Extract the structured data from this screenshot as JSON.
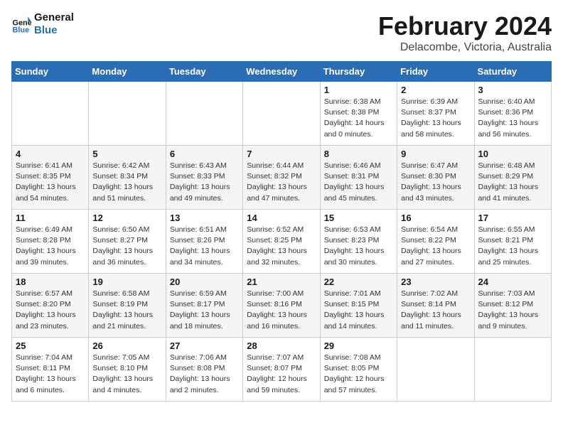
{
  "logo": {
    "line1": "General",
    "line2": "Blue"
  },
  "title": "February 2024",
  "location": "Delacombe, Victoria, Australia",
  "weekdays": [
    "Sunday",
    "Monday",
    "Tuesday",
    "Wednesday",
    "Thursday",
    "Friday",
    "Saturday"
  ],
  "weeks": [
    [
      {
        "day": "",
        "info": ""
      },
      {
        "day": "",
        "info": ""
      },
      {
        "day": "",
        "info": ""
      },
      {
        "day": "",
        "info": ""
      },
      {
        "day": "1",
        "info": "Sunrise: 6:38 AM\nSunset: 8:38 PM\nDaylight: 14 hours\nand 0 minutes."
      },
      {
        "day": "2",
        "info": "Sunrise: 6:39 AM\nSunset: 8:37 PM\nDaylight: 13 hours\nand 58 minutes."
      },
      {
        "day": "3",
        "info": "Sunrise: 6:40 AM\nSunset: 8:36 PM\nDaylight: 13 hours\nand 56 minutes."
      }
    ],
    [
      {
        "day": "4",
        "info": "Sunrise: 6:41 AM\nSunset: 8:35 PM\nDaylight: 13 hours\nand 54 minutes."
      },
      {
        "day": "5",
        "info": "Sunrise: 6:42 AM\nSunset: 8:34 PM\nDaylight: 13 hours\nand 51 minutes."
      },
      {
        "day": "6",
        "info": "Sunrise: 6:43 AM\nSunset: 8:33 PM\nDaylight: 13 hours\nand 49 minutes."
      },
      {
        "day": "7",
        "info": "Sunrise: 6:44 AM\nSunset: 8:32 PM\nDaylight: 13 hours\nand 47 minutes."
      },
      {
        "day": "8",
        "info": "Sunrise: 6:46 AM\nSunset: 8:31 PM\nDaylight: 13 hours\nand 45 minutes."
      },
      {
        "day": "9",
        "info": "Sunrise: 6:47 AM\nSunset: 8:30 PM\nDaylight: 13 hours\nand 43 minutes."
      },
      {
        "day": "10",
        "info": "Sunrise: 6:48 AM\nSunset: 8:29 PM\nDaylight: 13 hours\nand 41 minutes."
      }
    ],
    [
      {
        "day": "11",
        "info": "Sunrise: 6:49 AM\nSunset: 8:28 PM\nDaylight: 13 hours\nand 39 minutes."
      },
      {
        "day": "12",
        "info": "Sunrise: 6:50 AM\nSunset: 8:27 PM\nDaylight: 13 hours\nand 36 minutes."
      },
      {
        "day": "13",
        "info": "Sunrise: 6:51 AM\nSunset: 8:26 PM\nDaylight: 13 hours\nand 34 minutes."
      },
      {
        "day": "14",
        "info": "Sunrise: 6:52 AM\nSunset: 8:25 PM\nDaylight: 13 hours\nand 32 minutes."
      },
      {
        "day": "15",
        "info": "Sunrise: 6:53 AM\nSunset: 8:23 PM\nDaylight: 13 hours\nand 30 minutes."
      },
      {
        "day": "16",
        "info": "Sunrise: 6:54 AM\nSunset: 8:22 PM\nDaylight: 13 hours\nand 27 minutes."
      },
      {
        "day": "17",
        "info": "Sunrise: 6:55 AM\nSunset: 8:21 PM\nDaylight: 13 hours\nand 25 minutes."
      }
    ],
    [
      {
        "day": "18",
        "info": "Sunrise: 6:57 AM\nSunset: 8:20 PM\nDaylight: 13 hours\nand 23 minutes."
      },
      {
        "day": "19",
        "info": "Sunrise: 6:58 AM\nSunset: 8:19 PM\nDaylight: 13 hours\nand 21 minutes."
      },
      {
        "day": "20",
        "info": "Sunrise: 6:59 AM\nSunset: 8:17 PM\nDaylight: 13 hours\nand 18 minutes."
      },
      {
        "day": "21",
        "info": "Sunrise: 7:00 AM\nSunset: 8:16 PM\nDaylight: 13 hours\nand 16 minutes."
      },
      {
        "day": "22",
        "info": "Sunrise: 7:01 AM\nSunset: 8:15 PM\nDaylight: 13 hours\nand 14 minutes."
      },
      {
        "day": "23",
        "info": "Sunrise: 7:02 AM\nSunset: 8:14 PM\nDaylight: 13 hours\nand 11 minutes."
      },
      {
        "day": "24",
        "info": "Sunrise: 7:03 AM\nSunset: 8:12 PM\nDaylight: 13 hours\nand 9 minutes."
      }
    ],
    [
      {
        "day": "25",
        "info": "Sunrise: 7:04 AM\nSunset: 8:11 PM\nDaylight: 13 hours\nand 6 minutes."
      },
      {
        "day": "26",
        "info": "Sunrise: 7:05 AM\nSunset: 8:10 PM\nDaylight: 13 hours\nand 4 minutes."
      },
      {
        "day": "27",
        "info": "Sunrise: 7:06 AM\nSunset: 8:08 PM\nDaylight: 13 hours\nand 2 minutes."
      },
      {
        "day": "28",
        "info": "Sunrise: 7:07 AM\nSunset: 8:07 PM\nDaylight: 12 hours\nand 59 minutes."
      },
      {
        "day": "29",
        "info": "Sunrise: 7:08 AM\nSunset: 8:05 PM\nDaylight: 12 hours\nand 57 minutes."
      },
      {
        "day": "",
        "info": ""
      },
      {
        "day": "",
        "info": ""
      }
    ]
  ]
}
